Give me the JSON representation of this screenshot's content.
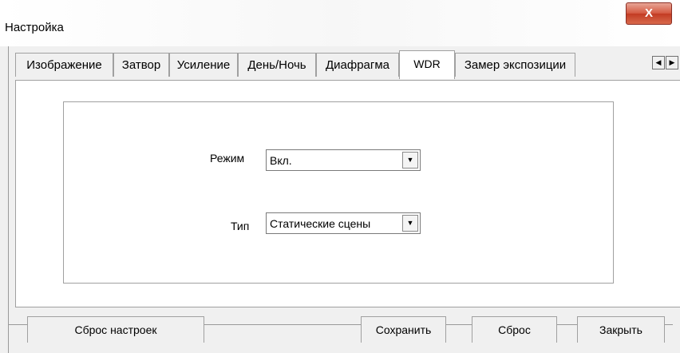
{
  "window": {
    "title": "Настройка",
    "close_label": "X"
  },
  "tabs": [
    {
      "label": "Изображение"
    },
    {
      "label": "Затвор"
    },
    {
      "label": "Усиление"
    },
    {
      "label": "День/Ночь"
    },
    {
      "label": "Диафрагма"
    },
    {
      "label": "WDR",
      "active": true
    },
    {
      "label": "Замер экспозиции"
    }
  ],
  "tab_scroll": {
    "left_icon": "arrow-left-icon",
    "right_icon": "arrow-right-icon",
    "left_glyph": "◀",
    "right_glyph": "▶"
  },
  "form": {
    "mode": {
      "label": "Режим",
      "value": "Вкл."
    },
    "type": {
      "label": "Тип",
      "value": "Статические сцены"
    },
    "dropdown_glyph": "▼"
  },
  "buttons": {
    "reset_settings": "Сброс настроек",
    "save": "Сохранить",
    "reset": "Сброс",
    "close": "Закрыть"
  }
}
